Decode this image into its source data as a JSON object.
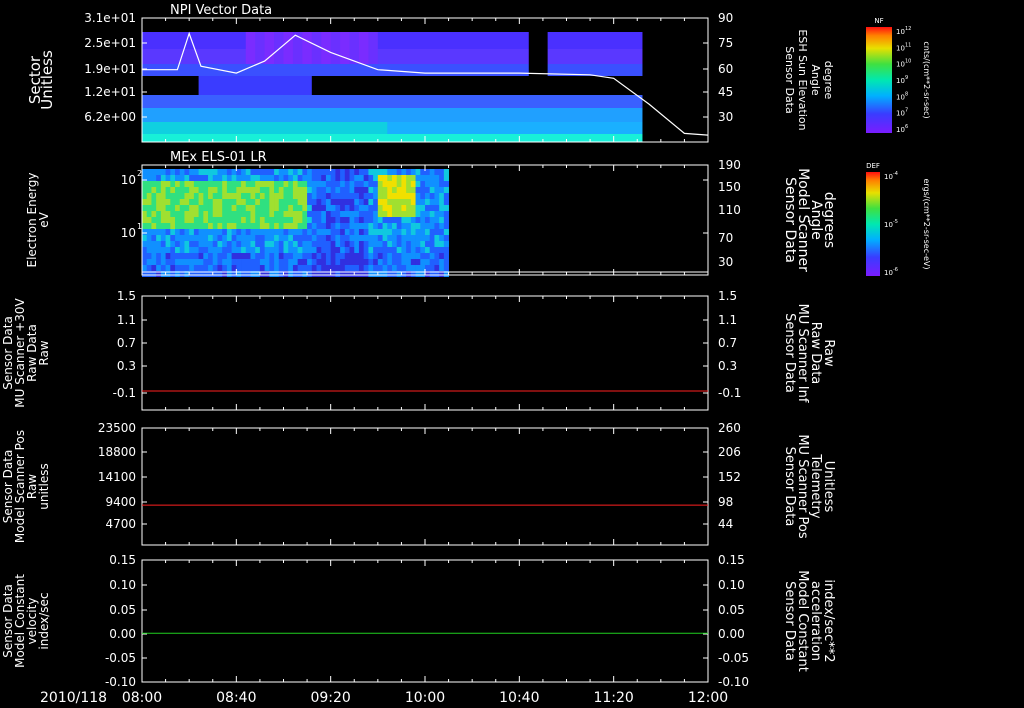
{
  "panels": [
    {
      "title": "NPI Vector Data",
      "left_label": [
        "Sector",
        "Unitless"
      ],
      "right_label": [
        "Sensor Data",
        "ESH Sun Elevation",
        "Angle",
        "degree"
      ],
      "right_label_color": "#ffffff",
      "left_ticks": [
        "3.1e+01",
        "2.5e+01",
        "1.9e+01",
        "1.2e+01",
        "6.2e+00"
      ],
      "right_ticks": [
        "90",
        "75",
        "60",
        "45",
        "30"
      ]
    },
    {
      "title": "MEx ELS-01 LR",
      "left_label": [
        "Electron Energy",
        "eV"
      ],
      "right_label": [
        "Sensor Data",
        "Model Scanner",
        "Angle",
        "degrees"
      ],
      "right_label_color": "#ffffff",
      "left_ticks": [
        "10",
        "10"
      ],
      "left_ticks_exp": [
        "2",
        "1"
      ],
      "right_ticks": [
        "190",
        "150",
        "110",
        "70",
        "30"
      ]
    },
    {
      "title": "",
      "left_label": [
        "Sensor Data",
        "MU Scanner +30V",
        "Raw Data",
        "Raw"
      ],
      "right_label": [
        "Sensor Data",
        "MU Scanner Inf",
        "Raw Data",
        "Raw"
      ],
      "right_label_color": "#ff2020",
      "left_ticks": [
        "1.5",
        "1.1",
        "0.7",
        "0.3",
        "-0.1"
      ],
      "right_ticks": [
        "1.5",
        "1.1",
        "0.7",
        "0.3",
        "-0.1"
      ]
    },
    {
      "title": "",
      "left_label": [
        "Sensor Data",
        "Model Scanner Pos",
        "Raw",
        "unitless"
      ],
      "right_label": [
        "Sensor Data",
        "MU Scanner Pos",
        "Telemetry",
        "Unitless"
      ],
      "right_label_color": "#ff2020",
      "left_ticks": [
        "23500",
        "18800",
        "14100",
        "9400",
        "4700"
      ],
      "right_ticks": [
        "260",
        "206",
        "152",
        "98",
        "44"
      ]
    },
    {
      "title": "",
      "left_label": [
        "Sensor Data",
        "Model Constant",
        "velocity",
        "index/sec"
      ],
      "right_label": [
        "Sensor Data",
        "Model Constant",
        "acceleration",
        "index/sec**2"
      ],
      "right_label_color": "#20ff20",
      "left_ticks": [
        "0.15",
        "0.10",
        "0.05",
        "0.00",
        "-0.05",
        "-0.10"
      ],
      "right_ticks": [
        "0.15",
        "0.10",
        "0.05",
        "0.00",
        "-0.05",
        "-0.10"
      ]
    }
  ],
  "time_axis": {
    "date": "2010/118",
    "labels": [
      "08:00",
      "08:40",
      "09:20",
      "10:00",
      "10:40",
      "11:20",
      "12:00"
    ]
  },
  "colorbars": [
    {
      "label": "NF",
      "unit": "cnts/(cm**2-sr-sec)",
      "ticks": [
        "10",
        "10",
        "10",
        "10",
        "10",
        "10",
        "10"
      ],
      "tick_exps": [
        "12",
        "11",
        "10",
        "9",
        "8",
        "7",
        "6"
      ]
    },
    {
      "label": "DEF",
      "unit": "ergs/(cm**2-sr-sec-eV)",
      "ticks": [
        "10",
        "10",
        "10"
      ],
      "tick_exps": [
        "-4",
        "-5",
        "-6"
      ]
    }
  ],
  "colors": {
    "red_line": "#ff2020",
    "green_line": "#20d020",
    "axis": "#ffffff"
  },
  "chart_data": [
    {
      "type": "heatmap",
      "title": "NPI Vector Data",
      "ylabel": "Sector Unitless",
      "y_ticks": [
        "3.1e+01",
        "2.5e+01",
        "1.9e+01",
        "1.2e+01",
        "6.2e+00"
      ],
      "x_range": [
        "08:00",
        "12:00"
      ],
      "data_coverage": [
        "08:00",
        "11:35"
      ],
      "overlay_line": {
        "label": "Sensor Data ESH Sun Elevation Angle degree",
        "y_range": [
          18,
          90
        ],
        "points": [
          [
            0,
            60
          ],
          [
            15,
            60
          ],
          [
            20,
            81
          ],
          [
            25,
            62
          ],
          [
            40,
            58
          ],
          [
            52,
            65
          ],
          [
            65,
            80
          ],
          [
            80,
            70
          ],
          [
            100,
            60
          ],
          [
            120,
            58
          ],
          [
            160,
            58
          ],
          [
            190,
            57
          ],
          [
            200,
            55
          ],
          [
            215,
            40
          ],
          [
            230,
            23
          ],
          [
            240,
            22
          ]
        ]
      }
    },
    {
      "type": "heatmap",
      "title": "MEx ELS-01 LR",
      "ylabel": "Electron Energy eV",
      "x_range": [
        "08:00",
        "12:00"
      ],
      "data_coverage": [
        "08:00",
        "10:10"
      ],
      "overlay_line": {
        "label": "Sensor Data Model Scanner Angle degrees",
        "y_range": [
          10,
          190
        ],
        "points": [
          [
            0,
            15
          ],
          [
            240,
            15
          ]
        ]
      }
    },
    {
      "type": "line",
      "series": [
        {
          "name": "Sensor Data MU Scanner +30V Raw Data Raw",
          "x": [
            0,
            240
          ],
          "values": [
            0,
            0
          ]
        }
      ],
      "ylim": [
        -0.3,
        1.5
      ]
    },
    {
      "type": "line",
      "series": [
        {
          "name": "Sensor Data Model Scanner Pos Raw unitless",
          "x": [
            0,
            240
          ],
          "values": [
            8000,
            8000
          ]
        }
      ],
      "ylim": [
        0,
        23500
      ]
    },
    {
      "type": "line",
      "series": [
        {
          "name": "Sensor Data Model Constant velocity index/sec",
          "x": [
            0,
            240
          ],
          "values": [
            0,
            0
          ]
        }
      ],
      "ylim": [
        -0.1,
        0.15
      ]
    }
  ]
}
